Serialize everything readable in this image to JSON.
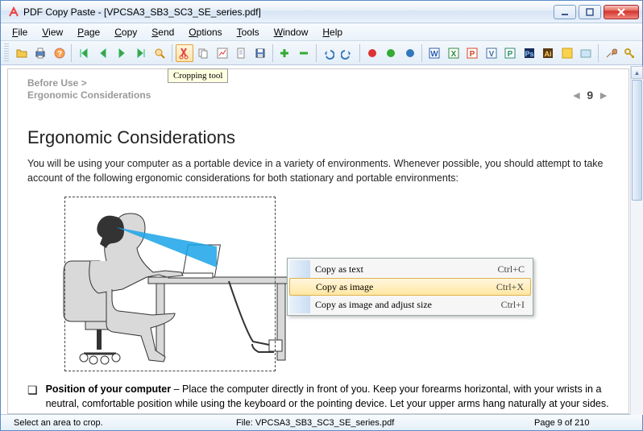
{
  "window": {
    "title": "PDF Copy Paste - [VPCSA3_SB3_SC3_SE_series.pdf]"
  },
  "menu": {
    "items": [
      "File",
      "View",
      "Page",
      "Copy",
      "Send",
      "Options",
      "Tools",
      "Window",
      "Help"
    ]
  },
  "toolbar": {
    "icons": [
      "open-icon",
      "print-icon",
      "help-icon",
      "first-icon",
      "prev-icon",
      "next-icon",
      "last-icon",
      "find-icon",
      "crop-tool-icon",
      "copy-icon",
      "chart-icon",
      "doc-icon",
      "save-icon",
      "add-icon",
      "remove-icon",
      "undo-icon",
      "redo-icon",
      "stop-icon",
      "record-icon",
      "play-icon",
      "word-icon",
      "excel-icon",
      "powerpoint-icon",
      "visio-icon",
      "publisher-icon",
      "photoshop-icon",
      "illustrator-icon",
      "yellow-app-icon",
      "folder-icon",
      "tools-icon",
      "key-icon"
    ]
  },
  "tooltip": {
    "text": "Cropping tool"
  },
  "document": {
    "breadcrumb1": "Before Use >",
    "breadcrumb2": "Ergonomic Considerations",
    "page_num": "9",
    "heading": "Ergonomic Considerations",
    "intro": "You will be using your computer as a portable device in a variety of environments. Whenever possible, you should attempt to take account of the following ergonomic considerations for both stationary and portable environments:",
    "item_title": "Position of your computer",
    "item_body": " – Place the computer directly in front of you. Keep your forearms horizontal, with your wrists in a neutral, comfortable position while using the keyboard or the pointing device. Let your upper arms hang naturally at your sides. Take frequent breaks while using your computer. Excessive use of the computer may strain eyes, muscles, or"
  },
  "contextmenu": {
    "items": [
      {
        "label": "Copy as text",
        "shortcut": "Ctrl+C"
      },
      {
        "label": "Copy as image",
        "shortcut": "Ctrl+X"
      },
      {
        "label": "Copy as image and adjust size",
        "shortcut": "Ctrl+I"
      }
    ],
    "highlighted": 1
  },
  "status": {
    "left": "Select an area to crop.",
    "mid": "File: VPCSA3_SB3_SC3_SE_series.pdf",
    "right": "Page 9 of 210"
  }
}
